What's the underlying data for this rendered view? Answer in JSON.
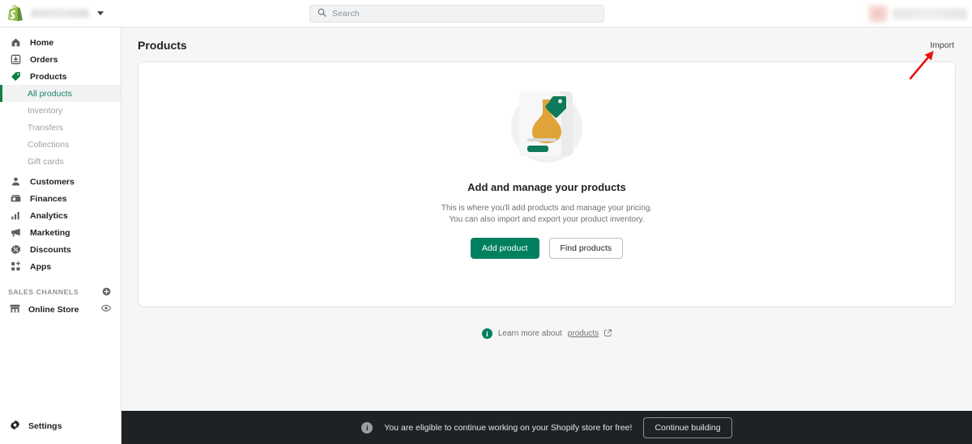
{
  "topbar": {
    "logo_icon": "shopify-logo-icon",
    "store_name_redacted": "",
    "store_dropdown_icon": "chevron-down-icon",
    "search": {
      "icon": "search-icon",
      "placeholder": "Search",
      "value": ""
    },
    "user": {
      "avatar_redacted": "",
      "name_redacted": ""
    }
  },
  "sidebar": {
    "items": [
      {
        "label": "Home",
        "icon": "home-icon",
        "active": false
      },
      {
        "label": "Orders",
        "icon": "orders-inbox-icon",
        "active": false
      },
      {
        "label": "Products",
        "icon": "products-tag-icon",
        "active": true
      }
    ],
    "product_subitems": [
      {
        "label": "All products",
        "active": true
      },
      {
        "label": "Inventory",
        "active": false
      },
      {
        "label": "Transfers",
        "active": false
      },
      {
        "label": "Collections",
        "active": false
      },
      {
        "label": "Gift cards",
        "active": false
      }
    ],
    "items_lower": [
      {
        "label": "Customers",
        "icon": "customer-person-icon"
      },
      {
        "label": "Finances",
        "icon": "finances-bill-icon"
      },
      {
        "label": "Analytics",
        "icon": "analytics-bars-icon"
      },
      {
        "label": "Marketing",
        "icon": "marketing-megaphone-icon"
      },
      {
        "label": "Discounts",
        "icon": "discounts-percent-icon"
      },
      {
        "label": "Apps",
        "icon": "apps-grid-plus-icon"
      }
    ],
    "sales_channels": {
      "heading": "SALES CHANNELS",
      "add_icon": "circle-plus-icon",
      "channels": [
        {
          "label": "Online Store",
          "icon": "storefront-icon",
          "action_icon": "eye-icon"
        }
      ]
    },
    "settings": {
      "label": "Settings",
      "icon": "gear-icon"
    }
  },
  "main": {
    "page_title": "Products",
    "import_label": "Import",
    "empty_state": {
      "illustration": "product-card-vase-illustration",
      "title": "Add and manage your products",
      "description_line1": "This is where you'll add products and manage your pricing.",
      "description_line2": "You can also import and export your product inventory.",
      "primary_button": "Add product",
      "secondary_button": "Find products"
    },
    "learn_more": {
      "info_icon": "info-circle-icon",
      "prefix": "Learn more about",
      "link_text": "products",
      "external_icon": "external-link-icon"
    }
  },
  "annotation": {
    "type": "red-arrow",
    "color": "#ee1111",
    "points_to": "Import"
  },
  "banner": {
    "info_icon": "info-circle-icon",
    "text": "You are eligible to continue working on your Shopify store for free!",
    "button_label": "Continue building"
  },
  "colors": {
    "brand_green": "#008060",
    "active_green": "#108043",
    "active_text": "#13836a",
    "page_bg": "#f6f6f7",
    "banner_bg": "#1f2225",
    "annotation_red": "#ee1111"
  }
}
